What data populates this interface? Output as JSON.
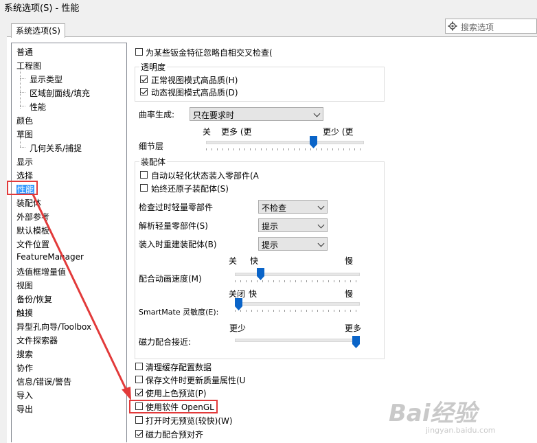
{
  "window": {
    "title": "系统选项(S) - 性能"
  },
  "tab": {
    "label": "系统选项(S)"
  },
  "search": {
    "placeholder": "搜索选项"
  },
  "tree": {
    "items": [
      "普通",
      "工程图",
      "显示类型",
      "区域剖面线/填充",
      "性能",
      "颜色",
      "草图",
      "几何关系/捕捉",
      "显示",
      "选择",
      "性能",
      "装配体",
      "外部参考",
      "默认模板",
      "文件位置",
      "FeatureManager",
      "选值框增量值",
      "视图",
      "备份/恢复",
      "触摸",
      "异型孔向导/Toolbox",
      "文件探索器",
      "搜索",
      "协作",
      "信息/错误/警告",
      "导入",
      "导出"
    ]
  },
  "options": {
    "sheetmetal_check": {
      "label": "为某些钣金特征忽略自相交叉检查(",
      "checked": false
    },
    "transparency": {
      "title": "透明度",
      "normal": {
        "label": "正常视图模式高品质(H)",
        "checked": true
      },
      "dynamic": {
        "label": "动态视图模式高品质(D)",
        "checked": true
      }
    },
    "curvature": {
      "label": "曲率生成:",
      "value": "只在要求时"
    },
    "lod": {
      "label": "细节层",
      "left": "关",
      "mid": "更多 (更",
      "right": "更少 (更",
      "level": 0.69
    },
    "assemblies": {
      "title": "装配体",
      "auto_lightweight": {
        "label": "自动以轻化状态装入零部件(A",
        "checked": false
      },
      "always_resolve": {
        "label": "始终还原子装配体(S)",
        "checked": false
      },
      "check_outdated": {
        "label": "检查过时轻量零部件",
        "value": "不检查"
      },
      "resolve_lightweight": {
        "label": "解析轻量零部件(S)",
        "value": "提示"
      },
      "rebuild_on_load": {
        "label": "装入时重建装配体(B)",
        "value": "提示"
      },
      "mate_anim": {
        "label": "配合动画速度(M)",
        "t1": "关",
        "t2": "快",
        "t3": "慢",
        "level": 0.19
      },
      "smartmate": {
        "label": "SmartMate 灵敏度(E):",
        "t1": "关闭",
        "t2": "快",
        "t3": "慢",
        "level": 0.0
      },
      "magnetic": {
        "label": "磁力配合接近:",
        "t1": "更少",
        "t2": "更多",
        "level": 1.0
      }
    },
    "purge_cache": {
      "label": "清理缓存配置数据",
      "checked": false
    },
    "update_mass": {
      "label": "保存文件时更新质量属性(U",
      "checked": false
    },
    "shaded_preview": {
      "label": "使用上色预览(P)",
      "checked": true
    },
    "software_opengl": {
      "label": "使用软件 OpenGL",
      "checked": false
    },
    "no_preview": {
      "label": "打开时无预览(较快)(W)",
      "checked": false
    },
    "magnetic_prealign": {
      "label": "磁力配合预对齐",
      "checked": true
    }
  },
  "watermark": {
    "text": "Bai经验",
    "sub": "jingyan.baidu.com"
  },
  "colors": {
    "accent": "#3399ff",
    "annotation": "#e23a3a",
    "thumb": "#0a64c8"
  }
}
